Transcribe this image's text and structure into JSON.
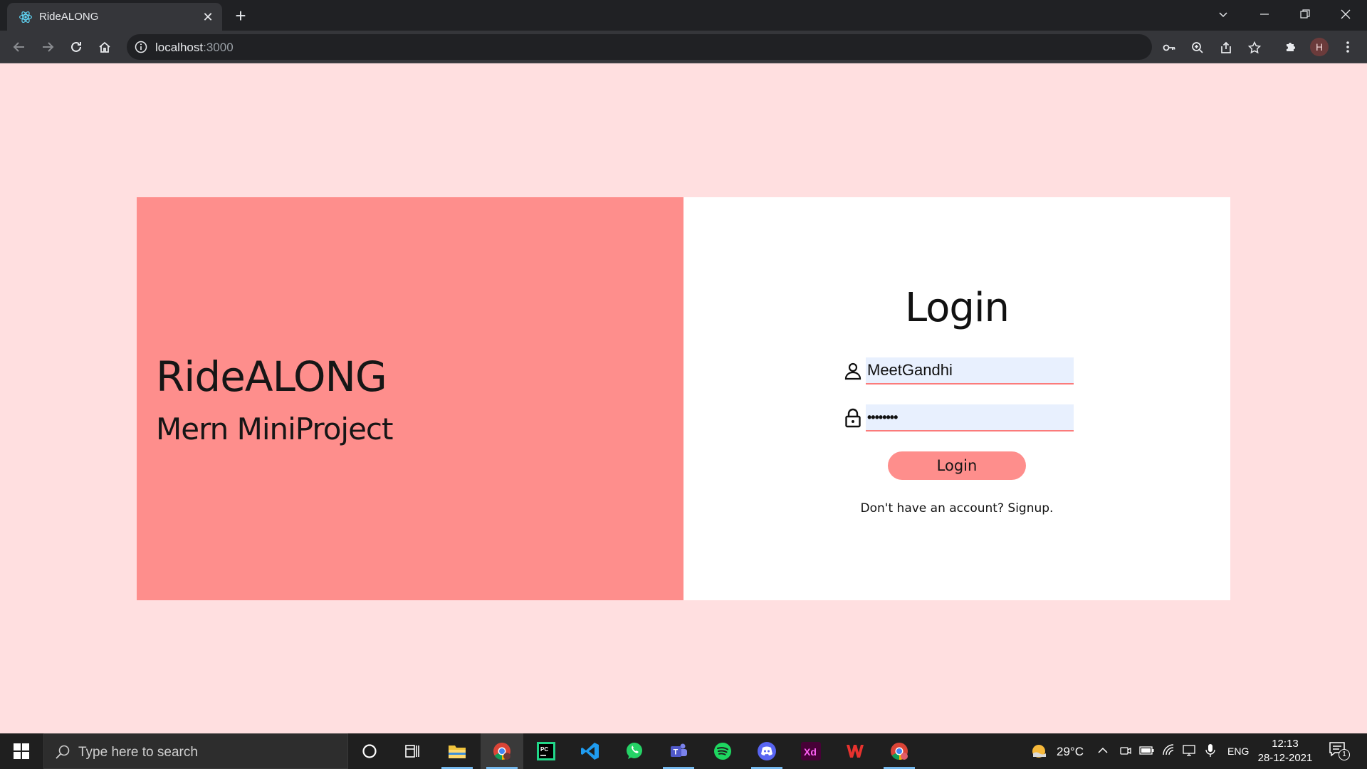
{
  "browser": {
    "tab_title": "RideALONG",
    "url_host": "localhost",
    "url_port": ":3000",
    "profile_initial": "H"
  },
  "page": {
    "brand_title": "RideALONG",
    "brand_subtitle": "Mern MiniProject",
    "login_heading": "Login",
    "username_value": "MeetGandhi",
    "password_value": "••••••••",
    "login_button": "Login",
    "signup_text": "Don't have an account? Signup."
  },
  "colors": {
    "page_bg": "#ffdfe0",
    "brand_panel": "#fe8e8c",
    "input_bg": "#e8f0fe",
    "input_underline": "#fb7b7b"
  },
  "taskbar": {
    "search_placeholder": "Type here to search",
    "weather": "29°C",
    "language": "ENG",
    "time": "12:13",
    "date": "28-12-2021",
    "notification_count": "1",
    "apps": [
      "cortana-icon",
      "task-view-icon",
      "file-explorer-icon",
      "chrome-icon",
      "pycharm-icon",
      "vscode-icon",
      "whatsapp-icon",
      "teams-icon",
      "spotify-icon",
      "discord-icon",
      "adobe-xd-icon",
      "wps-office-icon",
      "chrome-profile-icon"
    ]
  }
}
